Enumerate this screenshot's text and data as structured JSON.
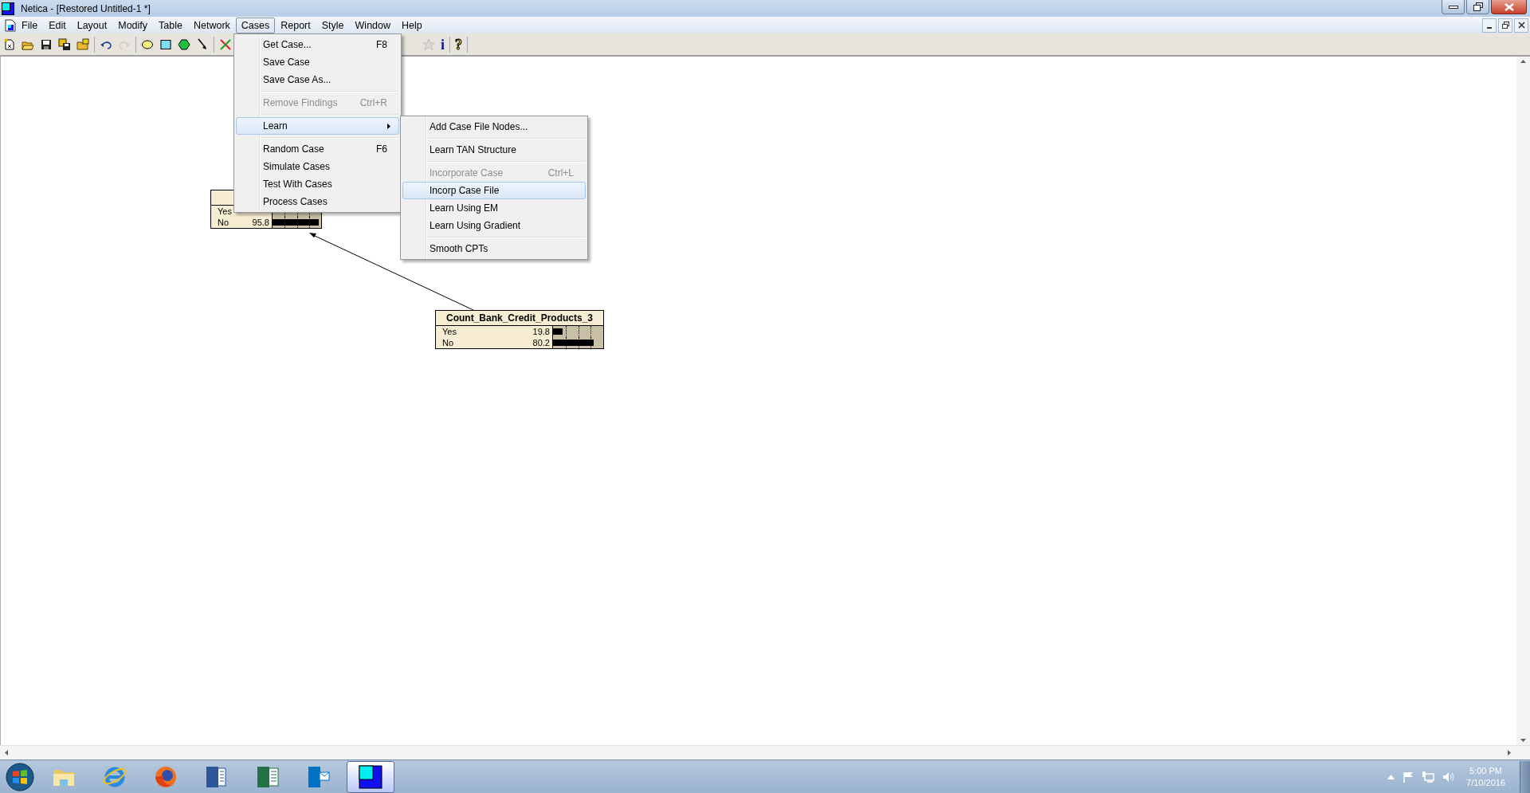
{
  "window": {
    "title": "Netica - [Restored Untitled-1 *]"
  },
  "menu_bar": [
    {
      "label": "File",
      "selected": false
    },
    {
      "label": "Edit",
      "selected": false
    },
    {
      "label": "Layout",
      "selected": false
    },
    {
      "label": "Modify",
      "selected": false
    },
    {
      "label": "Table",
      "selected": false
    },
    {
      "label": "Network",
      "selected": false
    },
    {
      "label": "Cases",
      "selected": true
    },
    {
      "label": "Report",
      "selected": false
    },
    {
      "label": "Style",
      "selected": false
    },
    {
      "label": "Window",
      "selected": false
    },
    {
      "label": "Help",
      "selected": false
    }
  ],
  "toolbar": {
    "left": [
      {
        "tools": [
          {
            "kind": "new",
            "disabled": false
          },
          {
            "kind": "open",
            "disabled": false
          },
          {
            "kind": "save",
            "disabled": false
          },
          {
            "kind": "save-all",
            "disabled": false
          },
          {
            "kind": "folder",
            "disabled": false
          }
        ]
      },
      {
        "tools": [
          {
            "kind": "undo",
            "disabled": false
          },
          {
            "kind": "redo",
            "disabled": true
          }
        ]
      },
      {
        "tools": [
          {
            "kind": "ellipse",
            "disabled": false
          },
          {
            "kind": "rectangle",
            "disabled": false
          },
          {
            "kind": "hexagon",
            "disabled": false
          },
          {
            "kind": "arrow",
            "disabled": false
          }
        ]
      },
      {
        "tools": [
          {
            "kind": "cross",
            "disabled": false
          }
        ]
      }
    ],
    "right": [
      {
        "tools": [
          {
            "kind": "star",
            "disabled": true
          },
          {
            "kind": "info",
            "glyph": "i",
            "disabled": false
          }
        ]
      },
      {
        "tools": [
          {
            "kind": "help",
            "glyph": "?",
            "disabled": false
          }
        ]
      }
    ]
  },
  "cases_menu": {
    "sections": [
      {
        "items": [
          {
            "label": "Get Case...",
            "shortcut": "F8",
            "disabled": false,
            "selected": false,
            "submenu": false
          },
          {
            "label": "Save Case",
            "disabled": false,
            "selected": false,
            "submenu": false
          },
          {
            "label": "Save Case As...",
            "disabled": false,
            "selected": false,
            "submenu": false
          }
        ]
      },
      {
        "items": [
          {
            "label": "Remove Findings",
            "shortcut": "Ctrl+R",
            "disabled": true,
            "selected": false,
            "submenu": false
          }
        ]
      },
      {
        "items": [
          {
            "label": "Learn",
            "disabled": false,
            "selected": true,
            "submenu": true
          }
        ]
      },
      {
        "items": [
          {
            "label": "Random Case",
            "shortcut": "F6",
            "disabled": false,
            "selected": false,
            "submenu": false
          },
          {
            "label": "Simulate Cases",
            "disabled": false,
            "selected": false,
            "submenu": false
          },
          {
            "label": "Test With Cases",
            "disabled": false,
            "selected": false,
            "submenu": false
          },
          {
            "label": "Process Cases",
            "disabled": false,
            "selected": false,
            "submenu": false
          }
        ]
      }
    ]
  },
  "learn_submenu": {
    "sections": [
      {
        "items": [
          {
            "label": "Add Case File Nodes...",
            "disabled": false,
            "selected": false,
            "submenu": false
          }
        ]
      },
      {
        "items": [
          {
            "label": "Learn TAN Structure",
            "disabled": false,
            "selected": false,
            "submenu": false
          }
        ]
      },
      {
        "items": [
          {
            "label": "Incorporate Case",
            "shortcut": "Ctrl+L",
            "disabled": true,
            "selected": false,
            "submenu": false
          },
          {
            "label": "Incorp Case File",
            "disabled": false,
            "selected": true,
            "submenu": false
          },
          {
            "label": "Learn Using EM",
            "disabled": false,
            "selected": false,
            "submenu": false
          },
          {
            "label": "Learn Using Gradient",
            "disabled": false,
            "selected": false,
            "submenu": false
          }
        ]
      },
      {
        "items": [
          {
            "label": "Smooth CPTs",
            "disabled": false,
            "selected": false,
            "submenu": false
          }
        ]
      }
    ]
  },
  "network": {
    "nodes": [
      {
        "states": [
          {
            "label": "Yes"
          },
          {
            "label": "No",
            "value": "95.8",
            "level": 0.958
          }
        ]
      },
      {
        "title": "Count_Bank_Credit_Products_3",
        "states": [
          {
            "label": "Yes",
            "value": "19.8",
            "level": 0.198
          },
          {
            "label": "No",
            "value": "80.2",
            "level": 0.802
          }
        ]
      }
    ]
  },
  "taskbar": {
    "apps": [
      {
        "kind": "folder",
        "selected": false
      },
      {
        "kind": "browser-e",
        "selected": false
      },
      {
        "kind": "browser-fox",
        "selected": false
      },
      {
        "kind": "word",
        "selected": false
      },
      {
        "kind": "excel",
        "selected": false
      },
      {
        "kind": "mail",
        "selected": false
      },
      {
        "kind": "netica",
        "selected": true
      }
    ],
    "clock": {
      "time": "5:00 PM",
      "date": "7/10/2016"
    }
  }
}
